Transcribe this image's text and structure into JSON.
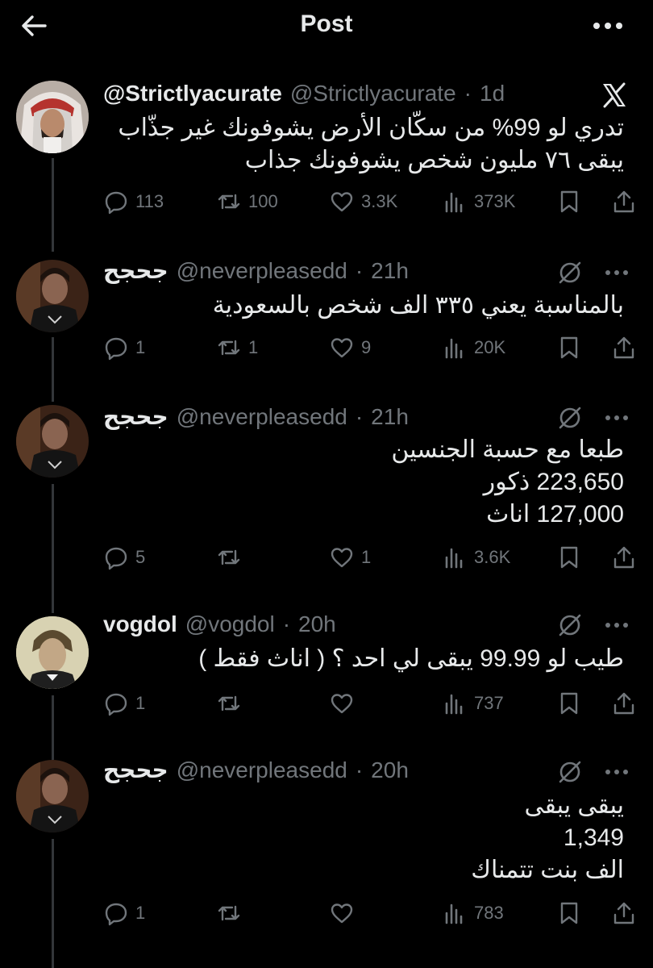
{
  "header": {
    "title": "Post"
  },
  "posts": [
    {
      "name": "@Strictlyacurate",
      "handle": "@Strictlyacurate",
      "dot": "·",
      "time": "1d",
      "lines": [
        "تدري لو 99% من سكّان الأرض يشوفونك غير جذّاب",
        "يبقى ٧٦ مليون شخص يشوفونك جذاب"
      ],
      "replies": "113",
      "retweets": "100",
      "likes": "3.3K",
      "views": "373K",
      "corner_icon": "x-logo-icon"
    },
    {
      "name": "جحجح",
      "handle": "@neverpleasedd",
      "dot": "·",
      "time": "21h",
      "lines": [
        "بالمناسبة يعني ٣٣٥ الف شخص بالسعودية"
      ],
      "replies": "1",
      "retweets": "1",
      "likes": "9",
      "views": "20K"
    },
    {
      "name": "جحجح",
      "handle": "@neverpleasedd",
      "dot": "·",
      "time": "21h",
      "lines": [
        "طبعا مع حسبة الجنسين",
        "223,650 ذكور",
        "127,000 اناث"
      ],
      "replies": "5",
      "retweets": "",
      "likes": "1",
      "views": "3.6K"
    },
    {
      "name": "vogdol",
      "handle": "@vogdol",
      "dot": "·",
      "time": "20h",
      "lines": [
        "طيب لو 99.99 يبقى لي احد ؟ ( اناث فقط )"
      ],
      "replies": "1",
      "retweets": "",
      "likes": "",
      "views": "737"
    },
    {
      "name": "جحجح",
      "handle": "@neverpleasedd",
      "dot": "·",
      "time": "20h",
      "lines": [
        "يبقى يبقى",
        "1,349",
        "الف بنت تتمناك"
      ],
      "replies": "1",
      "retweets": "",
      "likes": "",
      "views": "783"
    }
  ],
  "colors": {
    "background": "#000000",
    "text": "#e7e9ea",
    "muted": "#71767b",
    "thread_line": "#333639"
  },
  "icons": [
    "back-arrow-icon",
    "more-icon",
    "x-logo-icon",
    "grok-icon",
    "reply-icon",
    "retweet-icon",
    "like-icon",
    "views-icon",
    "bookmark-icon",
    "share-icon"
  ]
}
